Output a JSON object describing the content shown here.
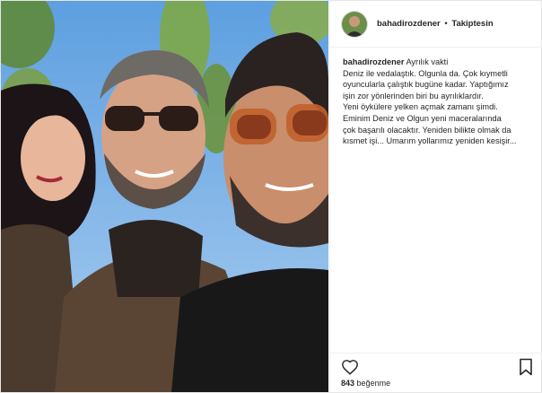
{
  "post": {
    "username": "bahadirozdener",
    "separator": "•",
    "follow_label": "Takiptesin",
    "photo_icon": "selfie-photo",
    "caption_user": "bahadirozdener",
    "caption_lines": [
      "Ayrılık vakti",
      "Deniz ile vedalaştık. Olgunla da. Çok kıymetli",
      "oyuncularla çalıştık bugüne kadar. Yaptığımız",
      "işin zor yönlerinden biri bu ayrılıklardır.",
      "Yeni öykülere yelken açmak zamanı şimdi.",
      "Eminim Deniz ve Olgun yeni maceralarında",
      "çok başarılı olacaktır. Yeniden bilikte olmak da",
      "kısmet işi... Umarım yollarımız yeniden kesişir..."
    ],
    "likes_count": "843",
    "likes_label": "beğenme",
    "heart_icon": "heart-icon",
    "bookmark_icon": "bookmark-icon"
  },
  "colors": {
    "text": "#262626",
    "border": "#efefef",
    "sky": "#7ab0e0"
  }
}
